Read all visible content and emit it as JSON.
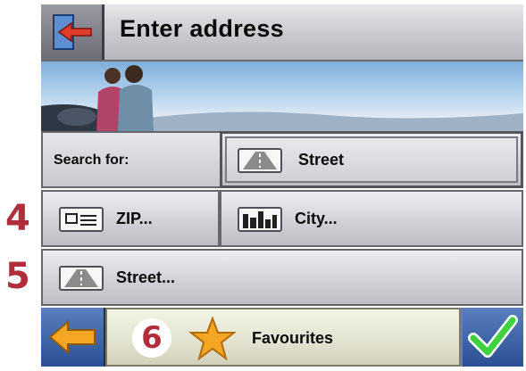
{
  "header": {
    "title": "Enter address",
    "back_icon": "exit-arrow-icon"
  },
  "search": {
    "label": "Search for:",
    "selected": "Street"
  },
  "options": [
    {
      "number": "4",
      "items": [
        {
          "label": "ZIP...",
          "icon": "zip-card-icon"
        },
        {
          "label": "City...",
          "icon": "city-icon"
        }
      ]
    },
    {
      "number": "5",
      "items": [
        {
          "label": "Street...",
          "icon": "road-icon"
        }
      ]
    }
  ],
  "footer": {
    "number": "6",
    "favourites_label": "Favourites",
    "back_icon": "arrow-left-icon",
    "ok_icon": "checkmark-icon"
  },
  "colors": {
    "step_number": "#b12d3a",
    "nav_blue": "#2a4f95",
    "star": "#f5a623",
    "check": "#3fd13f"
  }
}
